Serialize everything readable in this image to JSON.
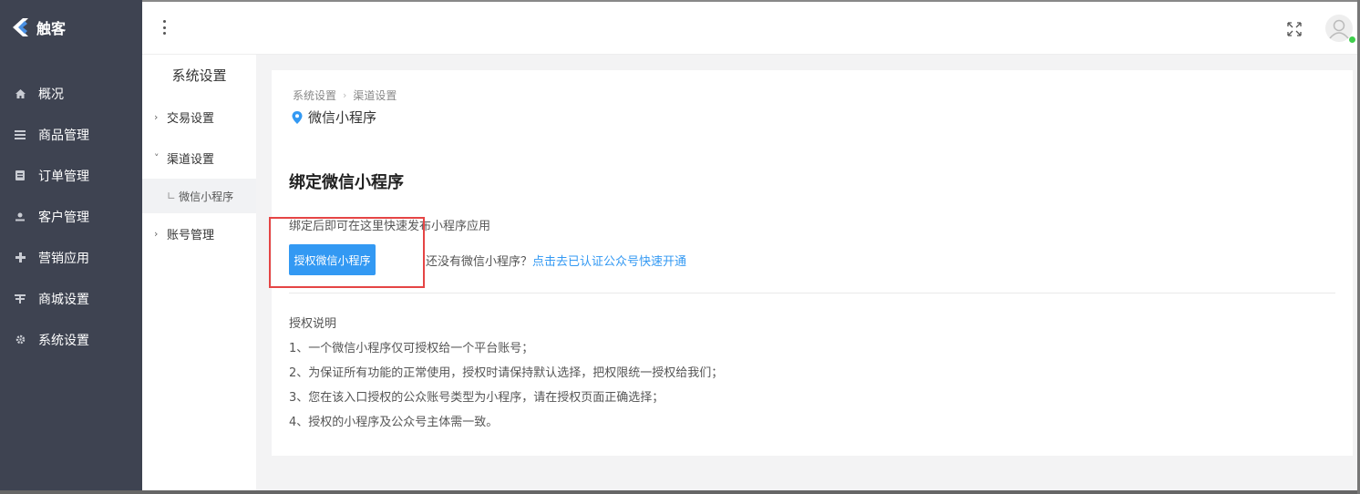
{
  "brand": {
    "name": "触客"
  },
  "nav": {
    "items": [
      {
        "label": "概况",
        "icon": "home-icon"
      },
      {
        "label": "商品管理",
        "icon": "list-icon"
      },
      {
        "label": "订单管理",
        "icon": "order-icon"
      },
      {
        "label": "客户管理",
        "icon": "user-icon"
      },
      {
        "label": "营销应用",
        "icon": "puzzle-icon"
      },
      {
        "label": "商城设置",
        "icon": "store-icon"
      },
      {
        "label": "系统设置",
        "icon": "gear-icon"
      }
    ]
  },
  "subnav": {
    "title": "系统设置",
    "items": [
      {
        "label": "交易设置",
        "caret": "›"
      },
      {
        "label": "渠道设置",
        "caret": "˅"
      },
      {
        "label": "账号管理",
        "caret": "›"
      }
    ],
    "child": {
      "label": "微信小程序",
      "tree": "∟"
    }
  },
  "breadcrumb": {
    "parent": "系统设置",
    "sep": "›",
    "current": "渠道设置"
  },
  "page": {
    "title": "微信小程序",
    "section_title": "绑定微信小程序",
    "section_desc": "绑定后即可在这里快速发布小程序应用",
    "auth_button": "授权微信小程序",
    "hint_text": "还没有微信小程序？",
    "hint_link": "点击去已认证公众号快速开通",
    "notes_title": "授权说明",
    "notes": [
      "1、一个微信小程序仅可授权给一个平台账号；",
      "2、为保证所有功能的正常使用，授权时请保持默认选择，把权限统一授权给我们；",
      "3、您在该入口授权的公众账号类型为小程序，请在授权页面正确选择；",
      "4、授权的小程序及公众号主体需一致。"
    ]
  },
  "colors": {
    "nav_bg": "#3e4351",
    "accent": "#3399f3",
    "highlight": "#e54545",
    "online": "#3ecf4b"
  }
}
